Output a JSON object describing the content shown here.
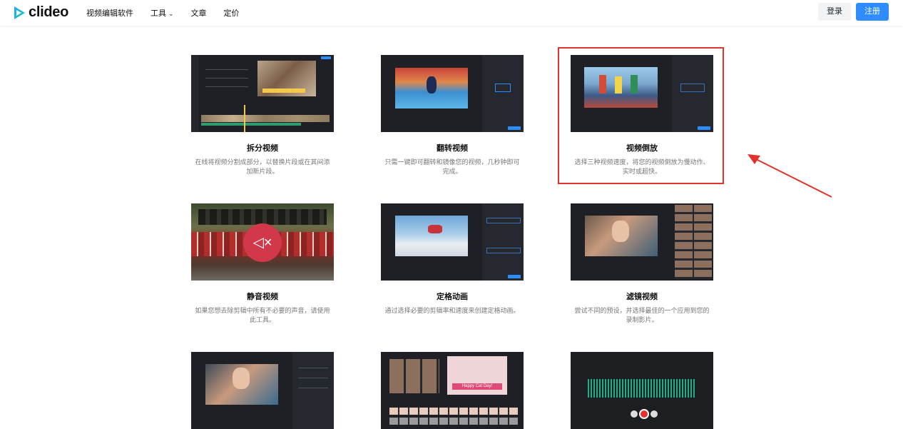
{
  "header": {
    "logo_text": "clideo",
    "nav": [
      {
        "label": "视频编辑软件"
      },
      {
        "label": "工具",
        "has_dropdown": true
      },
      {
        "label": "文章"
      },
      {
        "label": "定价"
      }
    ],
    "login_label": "登录",
    "signup_label": "注册"
  },
  "cards": [
    {
      "title": "拆分视频",
      "desc": "在线将视频分割成部分，以替换片段或在其间添加新片段。"
    },
    {
      "title": "翻转视频",
      "desc": "只需一键即可翻转和镜像您的视频，几秒钟即可完成。"
    },
    {
      "title": "视频倒放",
      "desc": "选择三种视频速度，将您的视频倒放为慢动作、实时或超快。"
    },
    {
      "title": "静音视频",
      "desc": "如果您想去除剪辑中所有不必要的声音，请使用此工具。"
    },
    {
      "title": "定格动画",
      "desc": "通过选择必要的剪辑率和速度来创建定格动画。"
    },
    {
      "title": "滤镜视频",
      "desc": "尝试不同的预设，并选择最佳的一个应用到您的录制影片。"
    },
    {
      "title": "",
      "desc": ""
    },
    {
      "title": "",
      "desc": ""
    },
    {
      "title": "",
      "desc": ""
    }
  ],
  "thumb_overlays": {
    "cat_card_text": "Happy Cat Day!"
  },
  "colors": {
    "accent": "#2e8cff",
    "highlight_border": "#e3312e",
    "thumb_bg": "#1e2026",
    "mute_circle": "#d1394a"
  }
}
